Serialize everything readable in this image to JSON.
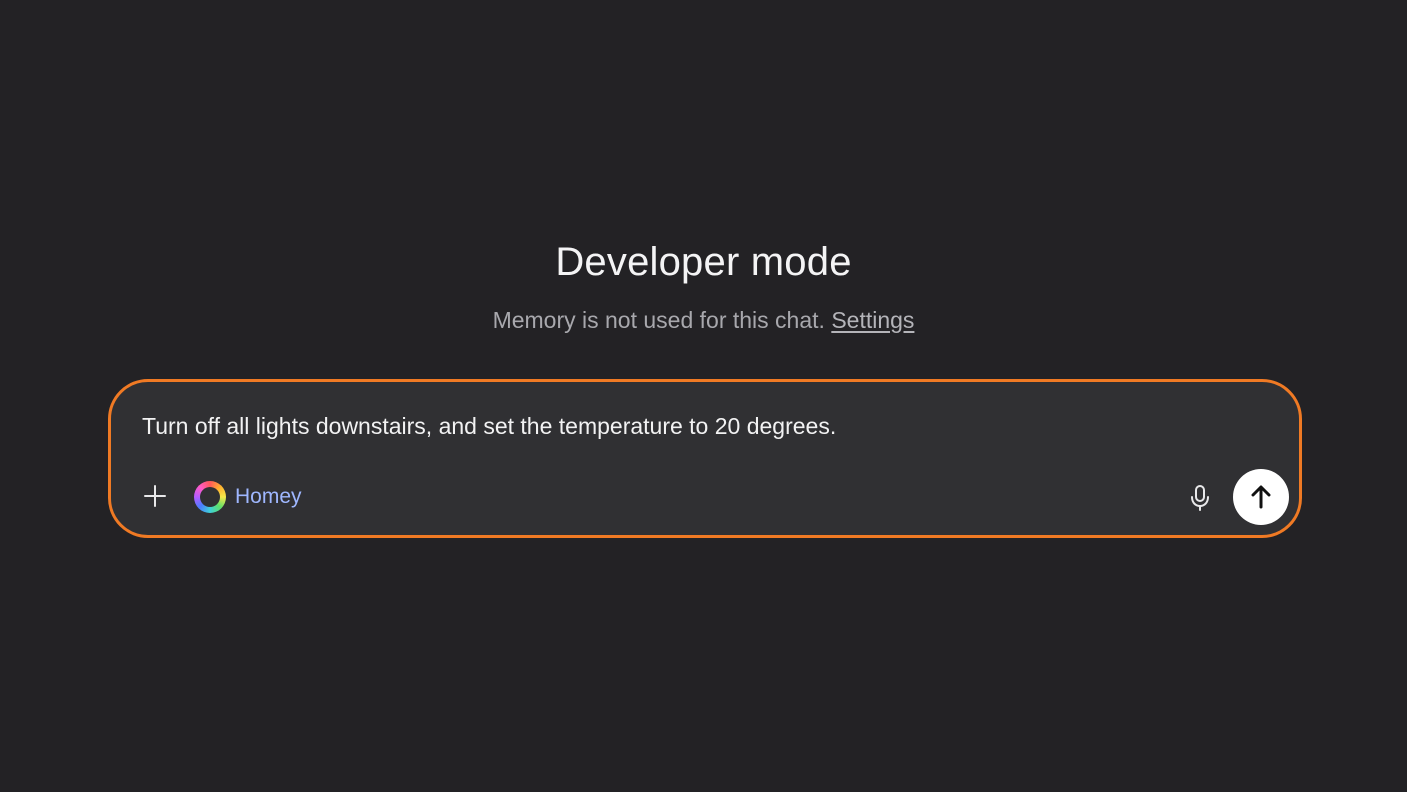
{
  "header": {
    "title": "Developer mode",
    "subtitle_text": "Memory is not used for this chat.",
    "subtitle_link": "Settings"
  },
  "composer": {
    "value": "Turn off all lights downstairs, and set the temperature to 20 degrees.",
    "connector_label": "Homey",
    "border_color": "#f07a24",
    "icons": {
      "attach": "plus-icon",
      "connector": "homey-logo-icon",
      "voice": "microphone-icon",
      "send": "arrow-up-icon"
    }
  },
  "colors": {
    "background": "#232225",
    "composer_background": "#303033",
    "accent": "#f07a24",
    "connector_text": "#9fb7ff"
  }
}
